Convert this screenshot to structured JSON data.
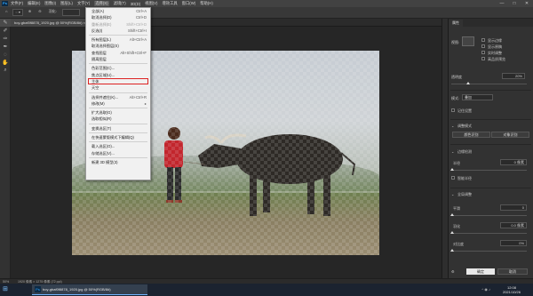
{
  "menubar": {
    "app_icon": "Ps",
    "items": [
      "文件(F)",
      "编辑(E)",
      "图像(I)",
      "图层(L)",
      "文字(Y)",
      "选择(S)",
      "滤镜(T)",
      "3D(D)",
      "视图(V)",
      "增效工具",
      "窗口(W)",
      "帮助(H)"
    ],
    "active_index": 5,
    "window_controls": [
      "—",
      "□",
      "✕"
    ]
  },
  "options_bar": {
    "feather_label": "羽化:",
    "refine_button": "调整边缘"
  },
  "document": {
    "tab_title": "boy-gbaf0f8878_1920.jpg @ 50%(RGB/8#) ×"
  },
  "select_menu": {
    "items": [
      {
        "label": "全部(A)",
        "shortcut": "Ctrl+A",
        "dim": false
      },
      {
        "label": "取消选择(D)",
        "shortcut": "Ctrl+D",
        "dim": false
      },
      {
        "label": "重新选择(E)",
        "shortcut": "Shift+Ctrl+D",
        "dim": true
      },
      {
        "label": "反选(I)",
        "shortcut": "Shift+Ctrl+I",
        "dim": false
      },
      {
        "sep": true
      },
      {
        "label": "所有图层(L)",
        "shortcut": "Alt+Ctrl+A",
        "dim": false
      },
      {
        "label": "取消选择图层(S)",
        "shortcut": "",
        "dim": false
      },
      {
        "label": "查找图层",
        "shortcut": "Alt+Shift+Ctrl+F",
        "dim": false
      },
      {
        "label": "隔离图层",
        "shortcut": "",
        "dim": false
      },
      {
        "sep": true
      },
      {
        "label": "色彩范围(C)...",
        "shortcut": "",
        "dim": false
      },
      {
        "label": "焦点区域(U)...",
        "shortcut": "",
        "dim": false
      },
      {
        "label": "主体",
        "shortcut": "",
        "dim": false,
        "highlight": true
      },
      {
        "label": "天空",
        "shortcut": "",
        "dim": false
      },
      {
        "sep": true
      },
      {
        "label": "选择并遮住(K)...",
        "shortcut": "Alt+Ctrl+R",
        "dim": false
      },
      {
        "label": "修改(M)",
        "shortcut": "▸",
        "dim": false
      },
      {
        "sep": true
      },
      {
        "label": "扩大选取(G)",
        "shortcut": "",
        "dim": false
      },
      {
        "label": "选取相似(R)",
        "shortcut": "",
        "dim": false
      },
      {
        "sep": true
      },
      {
        "label": "变换选区(T)",
        "shortcut": "",
        "dim": false
      },
      {
        "sep": true
      },
      {
        "label": "在快速蒙版模式下编辑(Q)",
        "shortcut": "",
        "dim": false
      },
      {
        "sep": true
      },
      {
        "label": "载入选区(O)...",
        "shortcut": "",
        "dim": false
      },
      {
        "label": "存储选区(V)...",
        "shortcut": "",
        "dim": false
      },
      {
        "sep": true
      },
      {
        "label": "新建 3D 模型(3)",
        "shortcut": "",
        "dim": false
      }
    ]
  },
  "properties_panel": {
    "tab": "属性",
    "view_label": "视图:",
    "show_edges": "显示边缘",
    "show_original": "显示原稿",
    "realtime": "实时调整",
    "high_quality": "高品质预览",
    "opacity_label": "透明度",
    "opacity_value": "20%",
    "mode_label": "模式:",
    "mode_value": "叠加",
    "remember_setting": "记住设置",
    "refine_mode_header": "调整模式",
    "refine_color": "颜色识别",
    "refine_object": "对象识别",
    "edge_detection_header": "边缘检测",
    "radius_label": "半径",
    "radius_value": "0 像素",
    "smart_radius": "智能半径",
    "global_refine_header": "全局调整",
    "smooth_label": "平滑",
    "smooth_value": "0",
    "feather_label": "羽化",
    "feather_value": "0.0 像素",
    "contrast_label": "对比度",
    "contrast_value": "0%",
    "ok": "确定",
    "cancel": "取消"
  },
  "status_bar": {
    "zoom": "50%",
    "doc_info": "1920 像素 × 1275 像素 (72 ppi)"
  },
  "taskbar": {
    "task_icon": "Ps",
    "task_title": "boy-gbaf0f8878_1920.jpg @ 50%(RGB/8#)",
    "time": "12:08",
    "date": "2021/10/26"
  },
  "colors": {
    "accent": "#31a8ff",
    "highlight_border": "#dd2222"
  }
}
